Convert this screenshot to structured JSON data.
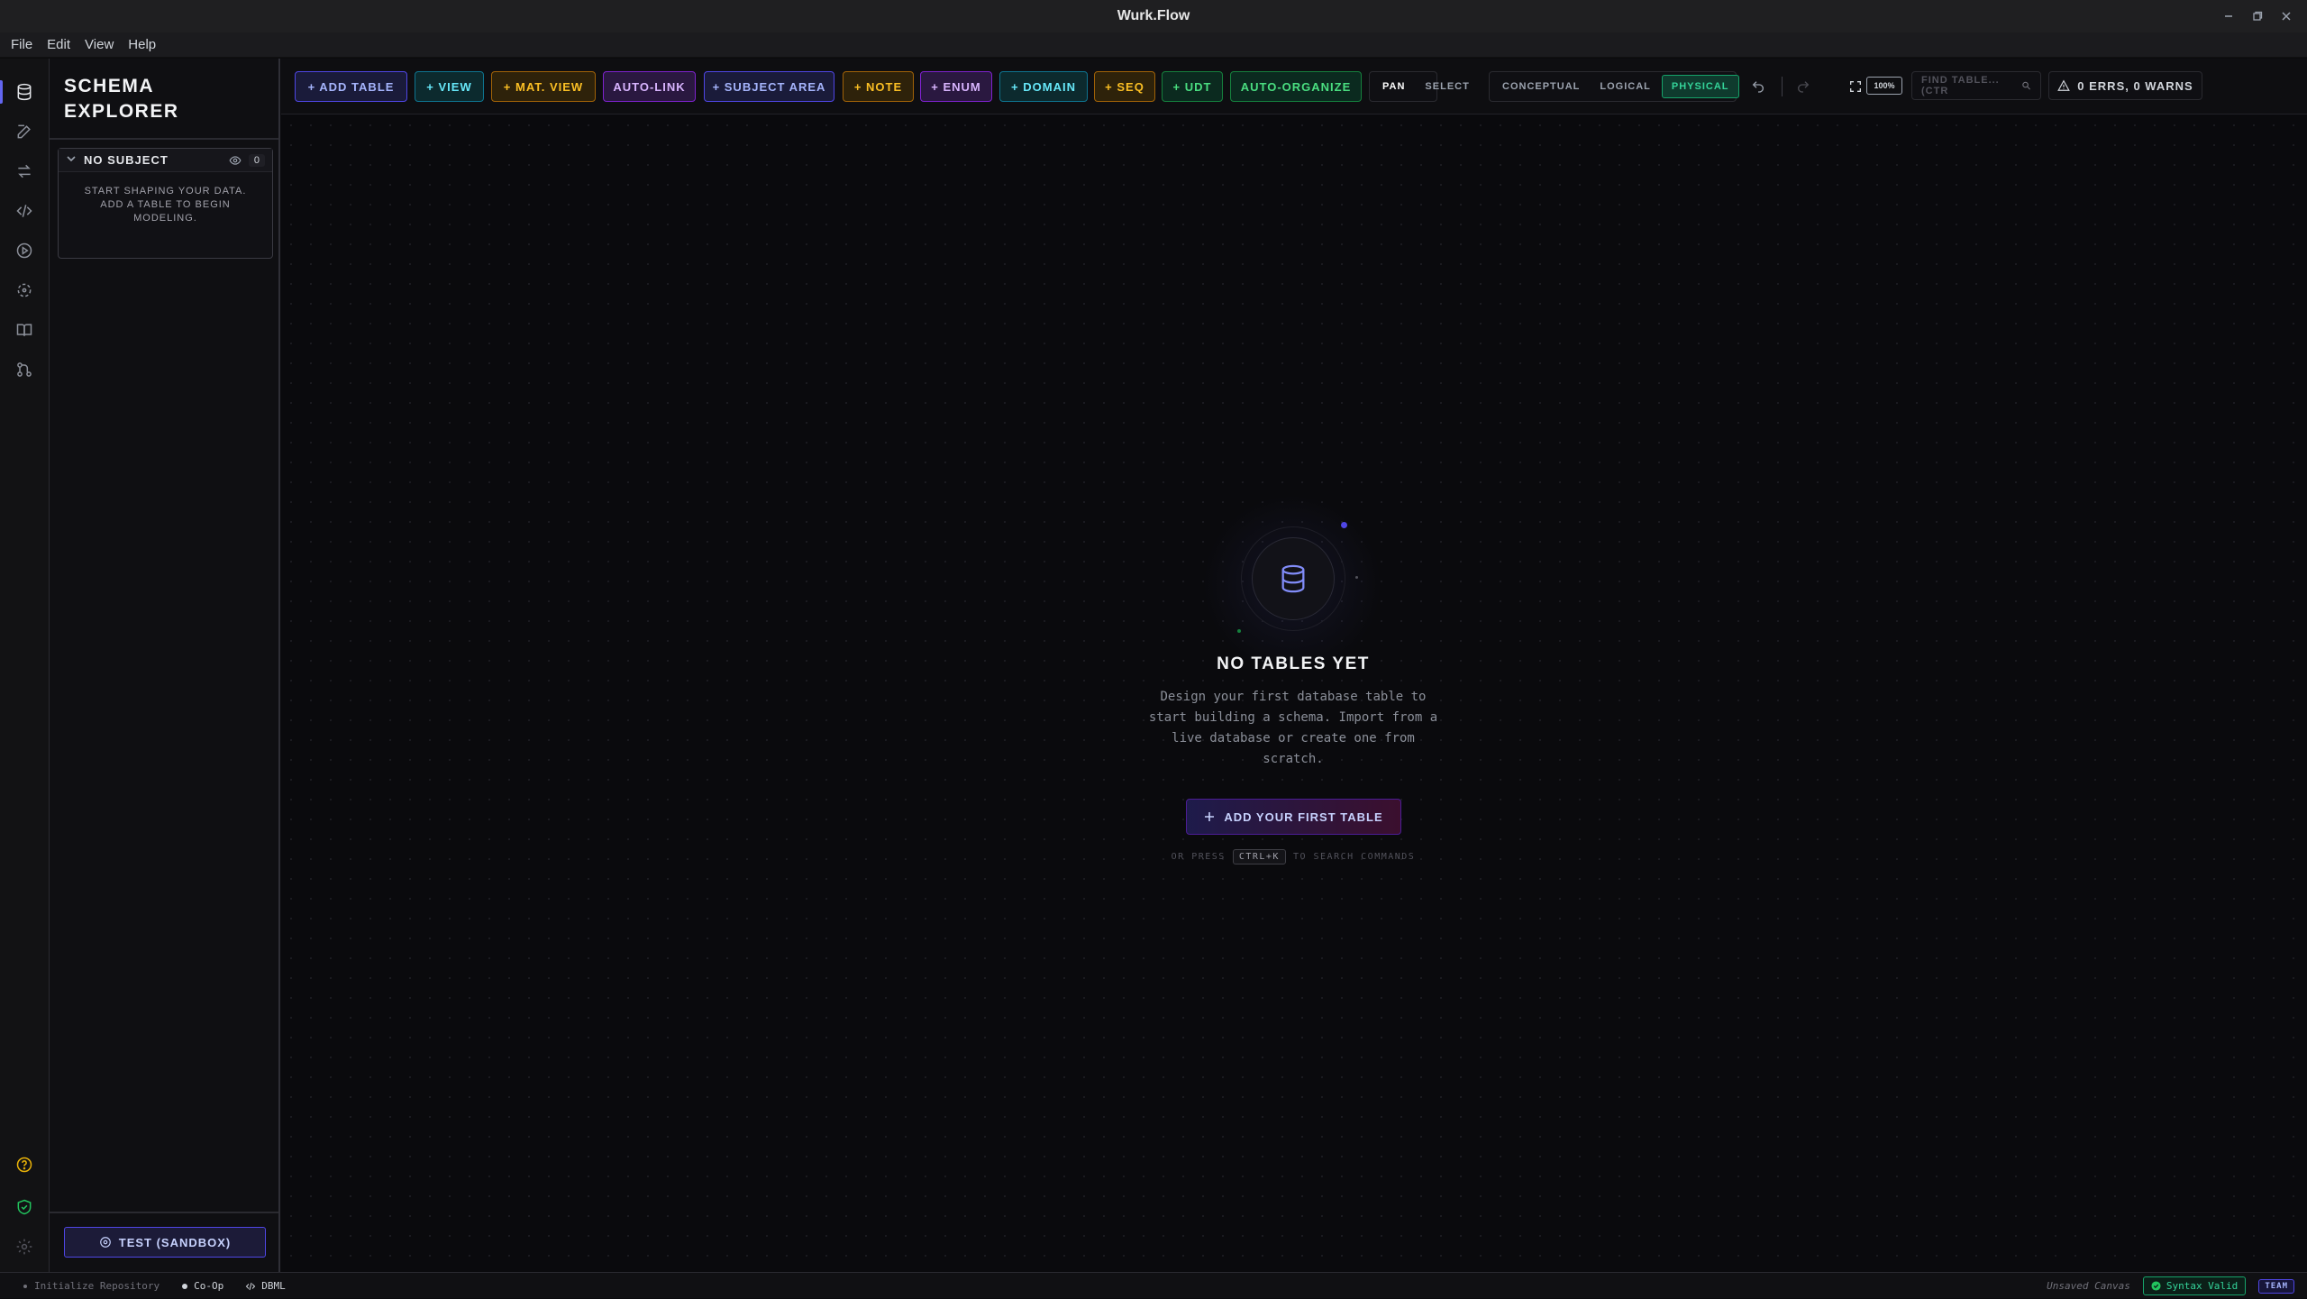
{
  "window": {
    "title": "Wurk.Flow"
  },
  "menu": [
    "File",
    "Edit",
    "View",
    "Help"
  ],
  "sidebar": {
    "title": "SCHEMA EXPLORER",
    "subject": {
      "label": "NO SUBJECT",
      "count": "0",
      "message": "START SHAPING YOUR DATA. ADD A TABLE TO BEGIN MODELING."
    },
    "test_button": "TEST (SANDBOX)"
  },
  "toolbar": {
    "add_table": "+ ADD TABLE",
    "view": "+ VIEW",
    "mat_view": "+ MAT. VIEW",
    "auto_link": "AUTO-LINK",
    "subject_area": "+ SUBJECT AREA",
    "note": "+ NOTE",
    "enum": "+ ENUM",
    "domain": "+ DOMAIN",
    "seq": "+ SEQ",
    "udt": "+ UDT",
    "auto_organize": "AUTO-ORGANIZE",
    "mode": {
      "pan": "PAN",
      "select": "SELECT",
      "active": "PAN"
    },
    "level": {
      "conceptual": "CONCEPTUAL",
      "logical": "LOGICAL",
      "physical": "PHYSICAL",
      "active": "PHYSICAL"
    },
    "zoom": "100%",
    "find_placeholder": "FIND TABLE... (CTR",
    "status": "0 ERRS, 0 WARNS"
  },
  "empty_state": {
    "title": "NO TABLES YET",
    "description": "Design your first database table to start building a schema. Import from a live database or create one from scratch.",
    "button": "ADD YOUR FIRST TABLE",
    "hint_prefix": "OR PRESS",
    "hint_key": "CTRL+K",
    "hint_suffix": "TO SEARCH COMMANDS"
  },
  "statusbar": {
    "repo": "Initialize Repository",
    "coop": "Co-Op",
    "dbml": "DBML",
    "unsaved": "Unsaved Canvas",
    "syntax": "Syntax Valid",
    "team": "TEAM"
  },
  "colors": {
    "accent": "#6366f1",
    "success": "#34d399"
  }
}
